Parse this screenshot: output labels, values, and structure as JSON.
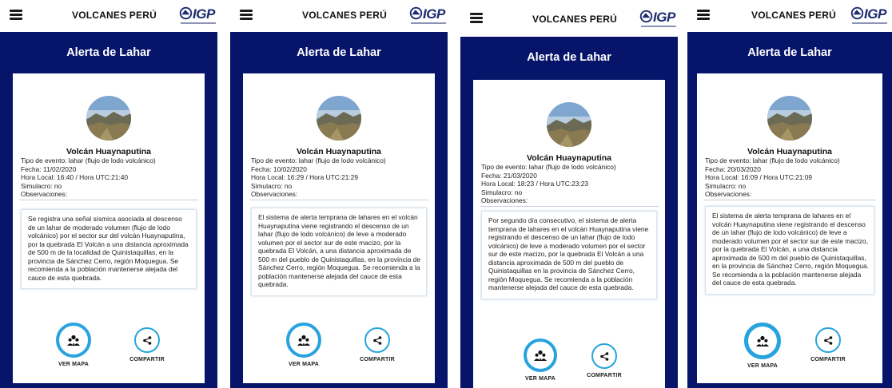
{
  "screens": [
    {
      "brand": "VOLCANES PERÚ",
      "logo_text": "IGP",
      "title": "Alerta de Lahar",
      "volcano": "Volcán Huaynaputina",
      "event_type": "Tipo de evento: lahar (flujo de lodo volcánico)",
      "date": "Fecha: 11/02/2020",
      "time": "Hora Local: 16:40 / Hora UTC:21:40",
      "simulation": "Simulacro: no",
      "observations": "Observaciones:",
      "message": "Se registra una señal sísmica asociada al descenso de un lahar de moderado volumen (flujo de lodo volcánico) por el sector sur del volcán Huaynaputina, por la quebrada El Volcán a una distancia aproximada de 500 m de la localidad de Quinistaquillas, en la provincia de Sánchez Cerro, región Moquegua. Se recomienda a la población mantenerse alejada del cauce de esta quebrada.",
      "map_label": "VER MAPA",
      "share_label": "COMPARTIR"
    },
    {
      "brand": "VOLCANES PERÚ",
      "logo_text": "IGP",
      "title": "Alerta de Lahar",
      "volcano": "Volcán Huaynaputina",
      "event_type": "Tipo de evento: lahar (flujo de lodo volcánico)",
      "date": "Fecha: 10/02/2020",
      "time": "Hora Local: 16:29 / Hora UTC:21:29",
      "simulation": "Simulacro: no",
      "observations": "Observaciones:",
      "message": "El sistema de alerta temprana de lahares en el volcán Huaynaputina viene registrando el descenso de un lahar (flujo de lodo volcánico) de leve a moderado volumen por el sector sur de este macizo, por la quebrada El Volcán, a una distancia aproximada de 500 m del pueblo de Quinistaquillas, en la provincia de Sánchez Cerro, región Moquegua. Se recomienda a la población mantenerse alejada del cauce de esta quebrada.",
      "map_label": "VER MAPA",
      "share_label": "COMPARTIR"
    },
    {
      "brand": "VOLCANES PERÚ",
      "logo_text": "IGP",
      "title": "Alerta de Lahar",
      "volcano": "Volcán Huaynaputina",
      "event_type": "Tipo de evento: lahar (flujo de lodo volcánico)",
      "date": "Fecha: 21/03/2020",
      "time": "Hora Local: 18:23 / Hora UTC:23:23",
      "simulation": "Simulacro: no",
      "observations": "Observaciones:",
      "message": "Por segundo día consecutivo, el sistema de alerta temprana de lahares en el volcán Huaynaputina viene registrando el descenso de un lahar (flujo de lodo volcánico) de leve a moderado volumen por el sector sur de este macizo, por la quebrada El Volcán a una distancia aproximada de 500 m del pueblo de Quinistaquillas en la provincia de Sánchez Cerro, región Moquegua. Se recomienda a la población mantenerse alejada del cauce de esta quebrada.",
      "map_label": "VER MAPA",
      "share_label": "COMPARTIR"
    },
    {
      "brand": "VOLCANES PERÚ",
      "logo_text": "IGP",
      "title": "Alerta de Lahar",
      "volcano": "Volcán Huaynaputina",
      "event_type": "Tipo de evento: lahar (flujo de lodo volcánico)",
      "date": "Fecha: 20/03/2020",
      "time": "Hora Local: 16:09 / Hora UTC:21:09",
      "simulation": "Simulacro: no",
      "observations": "Observaciones:",
      "message": "El sistema de alerta temprana de lahares en el volcán Huaynaputina viene registrando el descenso de un lahar (flujo de lodo volcánico) de leve a moderado volumen por el sector sur de este macizo, por la quebrada El Volcán, a una distancia aproximada de 500 m del pueblo de Quinistaquillas, en la provincia de Sánchez Cerro, región Moquegua. Se recomienda a la población mantenerse alejada del cauce de esta quebrada.",
      "map_label": "VER MAPA",
      "share_label": "COMPARTIR"
    }
  ],
  "icons": {
    "menu": "hamburger-menu-icon",
    "logo": "igp-logo-icon",
    "photo": "volcano-photo",
    "map": "map-people-icon",
    "share": "share-icon"
  },
  "colors": {
    "primary": "#06146a",
    "accent": "#27a3df",
    "logo": "#1b2b6e"
  }
}
